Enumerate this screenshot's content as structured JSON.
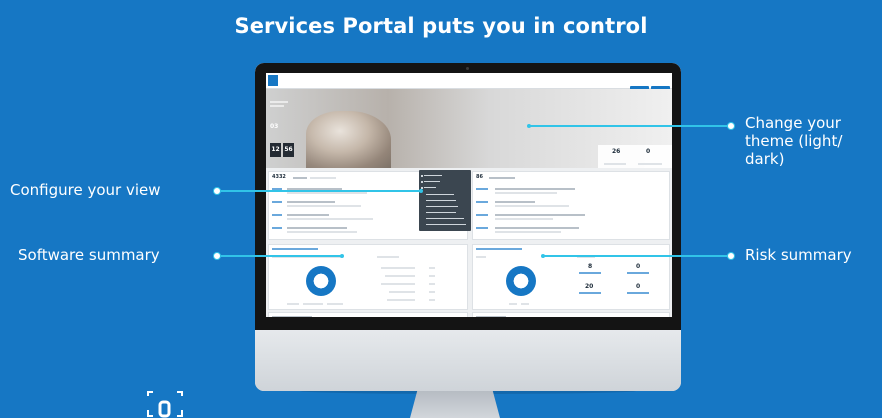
{
  "headline": "Services Portal puts you in control",
  "callouts": {
    "configure": "Configure your view",
    "software": "Software summary",
    "theme": "Change your theme (light/ dark)",
    "risk": "Risk summary"
  },
  "portal": {
    "widget_left_value": "4332",
    "widget_right_value": "86",
    "hero_value": "03",
    "date_day": "12",
    "date_minute": "56",
    "hero_stat_1": "26",
    "hero_stat_2": "0",
    "kpi_1": "8",
    "kpi_2": "0",
    "kpi_3": "20",
    "kpi_4": "0"
  },
  "colors": {
    "background": "#1677c4",
    "accent": "#31c4e8",
    "dark_menu": "#3b4650"
  }
}
